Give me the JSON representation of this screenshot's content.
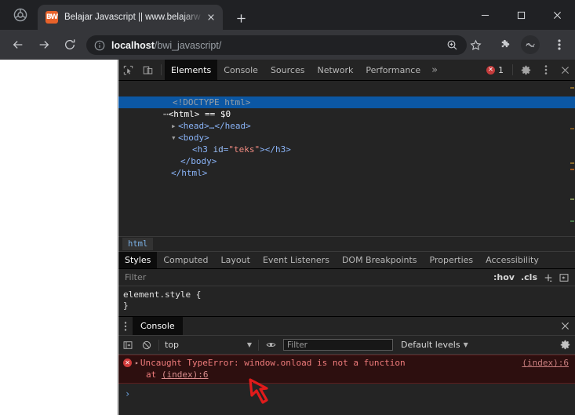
{
  "browser": {
    "brand_icon": "chrome-logo-icon",
    "tab": {
      "favicon_text": "BW",
      "title": "Belajar Javascript || www.belajarw",
      "close_icon": "close-icon"
    },
    "new_tab_label": "+",
    "window_controls": {
      "minimize": "minimize-icon",
      "maximize": "maximize-icon",
      "close": "close-icon"
    },
    "nav": {
      "back": "back-arrow-icon",
      "forward": "forward-arrow-icon",
      "reload": "reload-icon"
    },
    "omnibox": {
      "security_icon": "info-circle-icon",
      "url_host": "localhost",
      "url_path": "/bwi_javascript/",
      "zoom_icon": "zoom-search-icon",
      "bookmark_icon": "star-icon"
    },
    "extensions_icon": "puzzle-piece-icon",
    "avatar_label": "profile-avatar",
    "menu_icon": "three-dot-menu-icon"
  },
  "devtools": {
    "inspect_icon": "inspect-element-icon",
    "device_icon": "device-toolbar-icon",
    "tabs": [
      {
        "label": "Elements",
        "active": true
      },
      {
        "label": "Console",
        "active": false
      },
      {
        "label": "Sources",
        "active": false
      },
      {
        "label": "Network",
        "active": false
      },
      {
        "label": "Performance",
        "active": false
      }
    ],
    "more_tabs": "»",
    "error_count": "1",
    "settings_icon": "gear-icon",
    "kebab_icon": "three-dot-menu-icon",
    "close_icon": "close-icon",
    "dom_tree": [
      {
        "indent": 1,
        "toggle": "none",
        "selected": false,
        "kind": "doctype",
        "text": "<!DOCTYPE html>"
      },
      {
        "indent": 0,
        "toggle": "ellipsis",
        "selected": true,
        "kind": "html",
        "text": "<html> == $0"
      },
      {
        "indent": 1,
        "toggle": "closed",
        "selected": false,
        "kind": "head",
        "text": "<head>…</head>"
      },
      {
        "indent": 1,
        "toggle": "open",
        "selected": false,
        "kind": "body",
        "text": "<body>"
      },
      {
        "indent": 3,
        "toggle": "none",
        "selected": false,
        "kind": "h3",
        "text": "<h3 id=\"teks\"></h3>"
      },
      {
        "indent": 2,
        "toggle": "none",
        "selected": false,
        "kind": "close",
        "text": "</body>"
      },
      {
        "indent": 1,
        "toggle": "none",
        "selected": false,
        "kind": "close",
        "text": "</html>"
      }
    ],
    "breadcrumb": "html",
    "style_tabs": [
      {
        "label": "Styles",
        "active": true
      },
      {
        "label": "Computed",
        "active": false
      },
      {
        "label": "Layout",
        "active": false
      },
      {
        "label": "Event Listeners",
        "active": false
      },
      {
        "label": "DOM Breakpoints",
        "active": false
      },
      {
        "label": "Properties",
        "active": false
      },
      {
        "label": "Accessibility",
        "active": false
      }
    ],
    "style_filter_placeholder": "Filter",
    "style_hov": ":hov",
    "style_cls": ".cls",
    "style_add_icon": "plus-icon",
    "style_sidebar_icon": "toggle-sidebar-icon",
    "style_rule_open": "element.style {",
    "style_rule_close": "}"
  },
  "console": {
    "drawer_menu_icon": "three-dot-menu-icon",
    "drawer_tab": "Console",
    "drawer_close_icon": "close-icon",
    "sidebar_toggle_icon": "console-sidebar-icon",
    "clear_icon": "clear-console-icon",
    "context": "top",
    "context_caret": "▼",
    "eye_icon": "live-expression-eye-icon",
    "filter_placeholder": "Filter",
    "levels_label": "Default levels",
    "levels_caret": "▼",
    "settings_icon": "gear-icon",
    "messages": [
      {
        "level": "error",
        "icon": "error-circle-icon",
        "expand_caret": "▸",
        "text": "Uncaught TypeError: window.onload is not a function",
        "source": "(index):6",
        "stack_prefix": "at ",
        "stack_link": "(index):6"
      }
    ],
    "prompt_caret": "›"
  },
  "annotation": {
    "cursor_icon": "red-arrow-cursor-annotation",
    "color": "#e01b1b"
  }
}
